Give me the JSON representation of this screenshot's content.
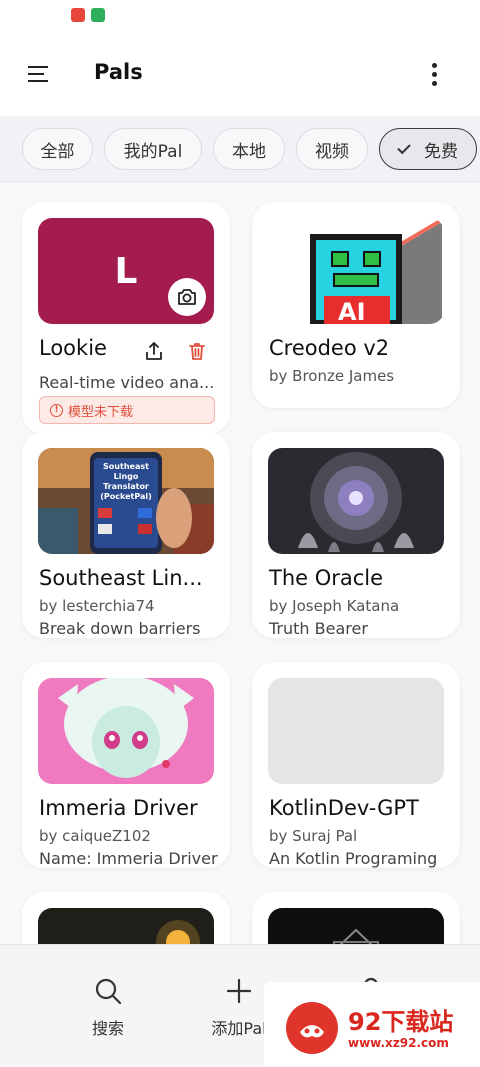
{
  "header": {
    "title": "Pals"
  },
  "filters": [
    {
      "label": "全部"
    },
    {
      "label": "我的Pal"
    },
    {
      "label": "本地"
    },
    {
      "label": "视频"
    },
    {
      "label": "免费"
    }
  ],
  "cards": [
    {
      "title": "Lookie",
      "author": "",
      "description": "Real-time video ana...",
      "thumb_letter": "L",
      "badge": "模型未下载"
    },
    {
      "title": "Creodeo v2",
      "author": "by Bronze James",
      "description": ""
    },
    {
      "title": "Southeast Lin...",
      "author": "by lesterchia74",
      "description": "Break down barriers with the dedicated ...",
      "thumb_text": "Southeast Lingo Translator (PocketPal)"
    },
    {
      "title": "The Oracle",
      "author": "by Joseph Katana",
      "description": "Truth Bearer"
    },
    {
      "title": "Immeria Driver",
      "author": "by caiqueZ102",
      "description": "Name: Immeria Driver (nickname: ..."
    },
    {
      "title": "KotlinDev-GPT",
      "author": "by Suraj Pal",
      "description": "An Kotlin Programing agent"
    }
  ],
  "bottom_nav": [
    {
      "label": "搜索"
    },
    {
      "label": "添加Pal"
    }
  ],
  "watermark": {
    "name": "92下载站",
    "url": "www.xz92.com"
  },
  "colors": {
    "accent_red": "#e0503c",
    "lookie_bg": "#a41c4e"
  }
}
